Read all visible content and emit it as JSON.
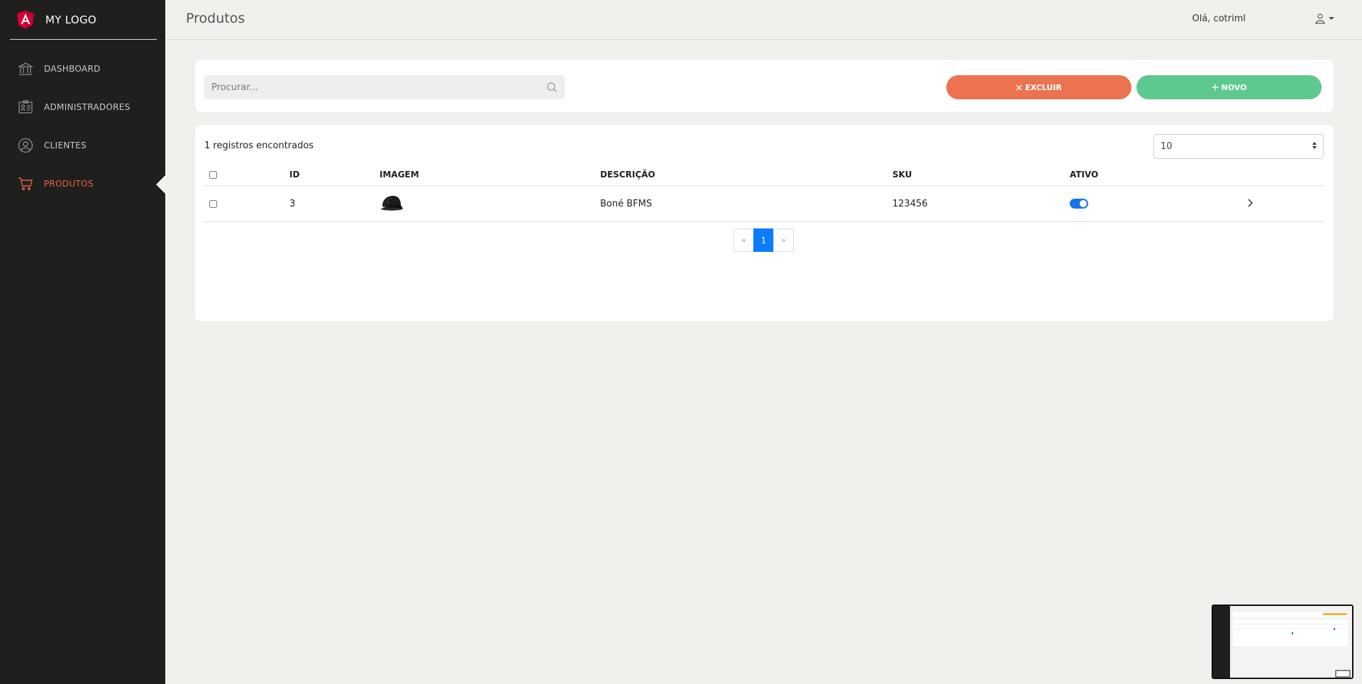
{
  "brand": {
    "name": "MY LOGO"
  },
  "sidebar": {
    "items": [
      {
        "label": "DASHBOARD",
        "icon": "bank-icon",
        "active": false
      },
      {
        "label": "ADMINISTRADORES",
        "icon": "id-card-icon",
        "active": false
      },
      {
        "label": "CLIENTES",
        "icon": "user-circle-icon",
        "active": false
      },
      {
        "label": "PRODUTOS",
        "icon": "shopping-cart-icon",
        "active": true
      }
    ]
  },
  "header": {
    "title": "Produtos",
    "greeting": "Olá, cotriml"
  },
  "search": {
    "placeholder": "Procurar...",
    "value": ""
  },
  "actions": {
    "delete_label": "EXCLUIR",
    "new_label": "NOVO"
  },
  "list": {
    "records_text": "1 registros encontrados",
    "page_size": "10",
    "columns": [
      "ID",
      "IMAGEM",
      "DESCRIÇÃO",
      "SKU",
      "ATIVO"
    ],
    "rows": [
      {
        "id": "3",
        "image": "cap-image",
        "description": "Boné BFMS",
        "sku": "123456",
        "active": true
      }
    ]
  },
  "pagination": {
    "prev": "«",
    "current": "1",
    "next": "»"
  },
  "colors": {
    "sidebar_bg": "#1f1f1e",
    "accent": "#e4633f",
    "delete": "#ec7350",
    "new": "#5dc98e",
    "primary": "#0b7bff"
  }
}
